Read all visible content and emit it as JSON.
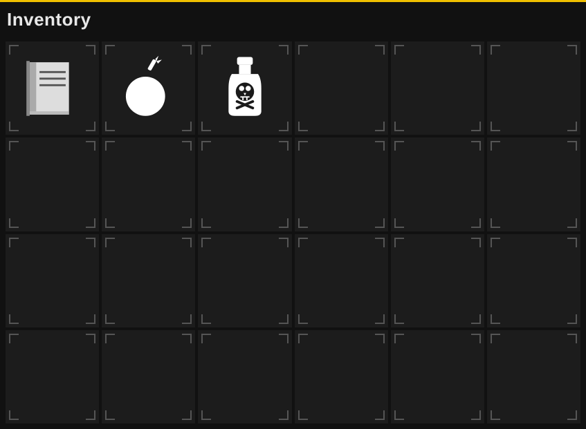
{
  "header": {
    "title": "Inventory",
    "border_color": "#f0c000"
  },
  "grid": {
    "rows": 4,
    "cols": 6,
    "items": [
      {
        "row": 0,
        "col": 0,
        "icon": "book"
      },
      {
        "row": 0,
        "col": 1,
        "icon": "bomb"
      },
      {
        "row": 0,
        "col": 2,
        "icon": "poison"
      }
    ]
  }
}
